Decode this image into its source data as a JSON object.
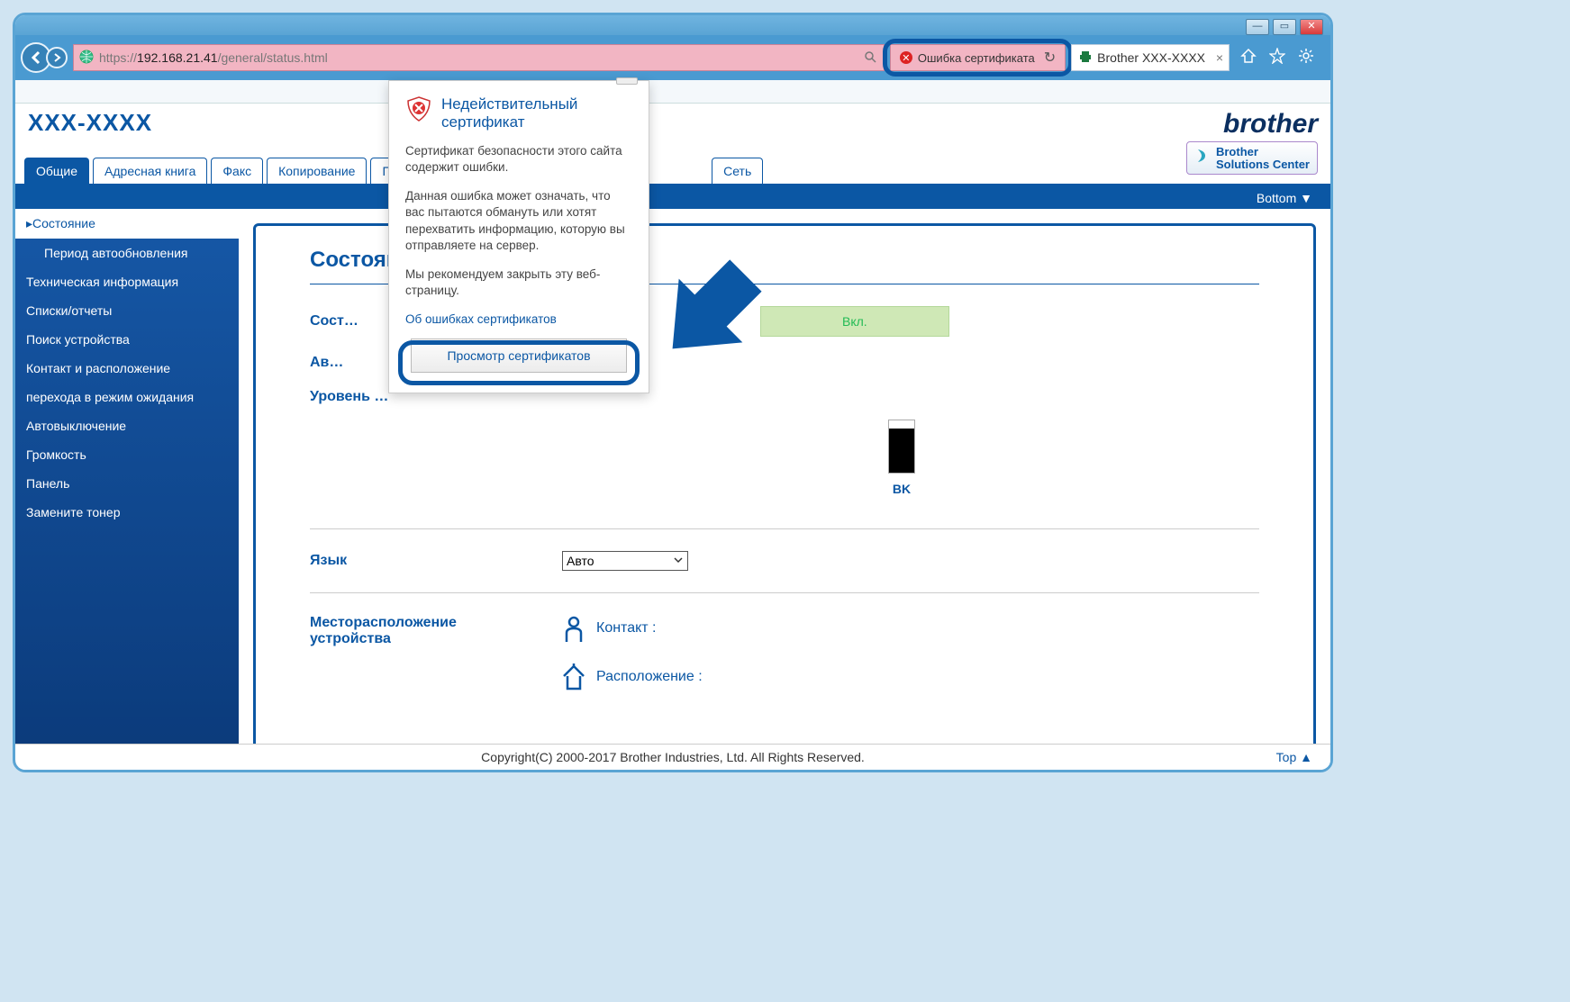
{
  "window": {
    "min": "—",
    "max": "▭",
    "close": "✕"
  },
  "browser": {
    "url_prefix": "https://",
    "url_host": "192.168.21.41",
    "url_path": "/general/status.html",
    "cert_error_label": "Ошибка сертификата",
    "tab_title": "Brother  XXX-XXXX"
  },
  "header": {
    "model": "XXX-XXXX",
    "brother": "brother",
    "solutions": "Brother\nSolutions Center"
  },
  "tabs": [
    "Общие",
    "Адресная книга",
    "Факс",
    "Копирование",
    "Печ…",
    "Сеть"
  ],
  "bottom_link": "Bottom ▼",
  "sidebar": {
    "active": "Состояние",
    "sub": "Период автообновления",
    "items": [
      "Техническая информация",
      "Списки/отчеты",
      "Поиск устройства",
      "Контакт и расположение",
      "перехода в режим ожидания",
      "Автовыключение",
      "Громкость",
      "Панель",
      "Замените тонер"
    ]
  },
  "main": {
    "title": "Состоян…",
    "status_label": "Сост…",
    "auto_label": "Ав…",
    "status_value": "Вкл.",
    "toner_label": "Уровень …",
    "toner_bk": "BK",
    "lang_label": "Язык",
    "lang_value": "Авто",
    "loc_label": "Месторасположение устройства",
    "contact_label": "Контакт :",
    "location_label": "Расположение :"
  },
  "flyout": {
    "title": "Недействительный сертификат",
    "p1": "Сертификат безопасности этого сайта содержит ошибки.",
    "p2": "Данная ошибка может означать, что вас пытаются обмануть или хотят перехватить информацию, которую вы отправляете на сервер.",
    "p3": "Мы рекомендуем закрыть эту веб-страницу.",
    "link": "Об ошибках сертификатов",
    "button": "Просмотр сертификатов"
  },
  "footer": {
    "copyright": "Copyright(C) 2000-2017 Brother Industries, Ltd. All Rights Reserved.",
    "top": "Top ▲"
  }
}
